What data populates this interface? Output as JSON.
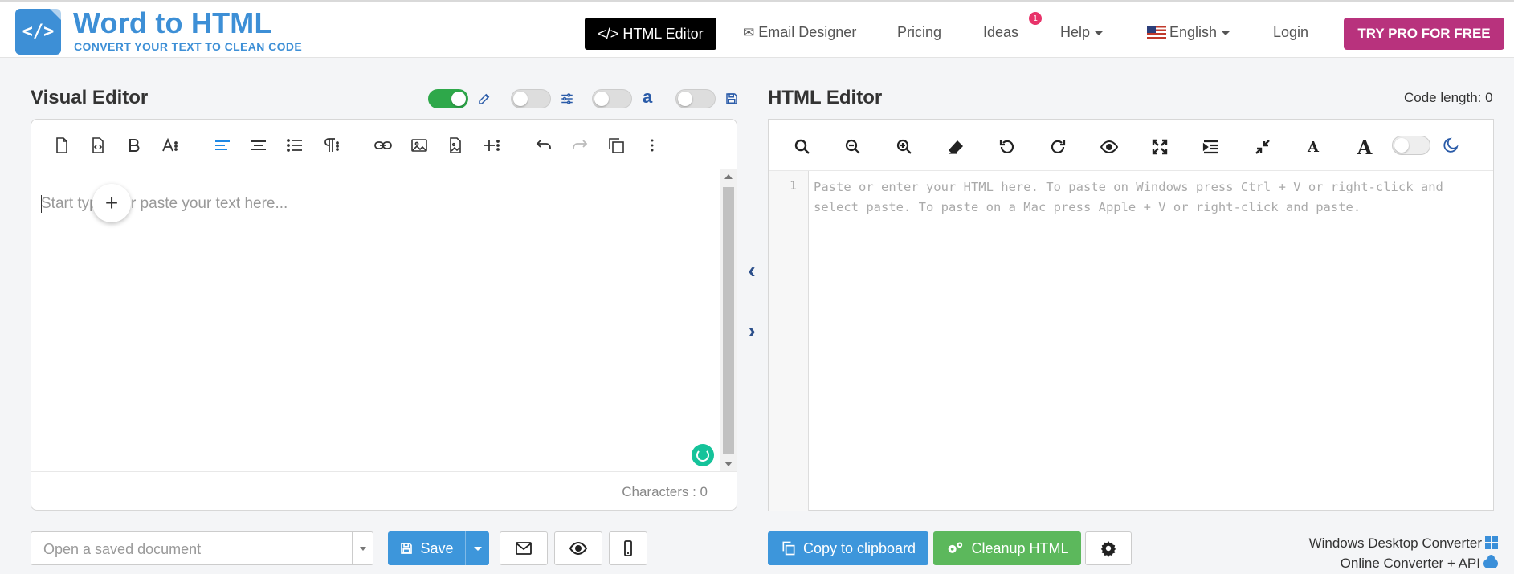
{
  "brand": {
    "logo_glyph": "</>",
    "title": "Word to HTML",
    "subtitle": "CONVERT YOUR TEXT TO CLEAN CODE",
    "color": "#3d8fd6"
  },
  "nav": {
    "html_editor": "</> HTML Editor",
    "email_designer": "Email Designer",
    "pricing": "Pricing",
    "ideas": "Ideas",
    "ideas_badge": "1",
    "help": "Help",
    "language": "English",
    "login": "Login",
    "try_pro": "TRY PRO FOR FREE",
    "try_pro_color": "#b8327d"
  },
  "visual_editor": {
    "title": "Visual Editor",
    "placeholder": "Start typing or paste your text here...",
    "characters_label": "Characters : 0",
    "toggles": [
      {
        "name": "edit",
        "on": true,
        "icon": "pencil-square-icon"
      },
      {
        "name": "settings",
        "on": false,
        "icon": "sliders-icon"
      },
      {
        "name": "amazon",
        "on": false,
        "icon": "amazon-icon"
      },
      {
        "name": "save",
        "on": false,
        "icon": "floppy-icon"
      }
    ],
    "toolbar_icons": [
      "new-document-icon",
      "html-file-icon",
      "bold-icon",
      "font-size-icon",
      "align-left-icon",
      "align-center-icon",
      "list-icon",
      "paragraph-icon",
      "link-icon",
      "image-icon",
      "file-image-icon",
      "insert-icon",
      "undo-icon",
      "redo-icon",
      "copy-icon",
      "more-icon"
    ]
  },
  "html_editor": {
    "title": "HTML Editor",
    "code_length": "Code length: 0",
    "line_number": "1",
    "placeholder": "Paste or enter your HTML here. To paste on Windows press Ctrl + V or right-click and select paste. To paste on a Mac press Apple + V or right-click and paste.",
    "toolbar_icons": [
      "search-icon",
      "zoom-out-icon",
      "zoom-in-icon",
      "eraser-icon",
      "undo-icon",
      "redo-icon",
      "eye-icon",
      "expand-icon",
      "indent-icon",
      "compress-icon",
      "font-small-icon",
      "font-large-icon",
      "moon-icon"
    ]
  },
  "bottom": {
    "open_saved": "Open a saved document",
    "save": "Save",
    "copy": "Copy to clipboard",
    "cleanup": "Cleanup HTML",
    "windows_converter": "Windows Desktop Converter",
    "online_converter": "Online Converter + API"
  }
}
